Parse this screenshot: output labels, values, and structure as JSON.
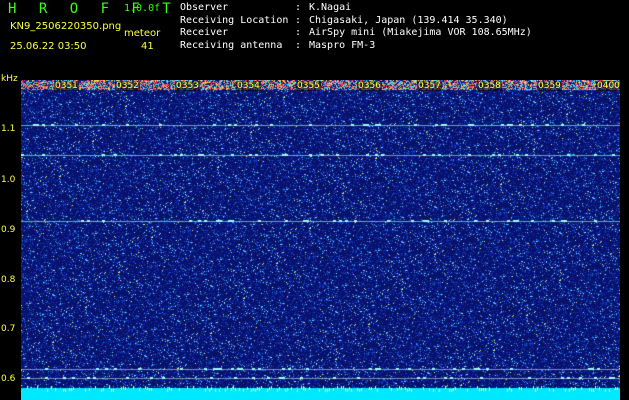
{
  "header": {
    "brand": "H R O F F T",
    "version": "1.0.0f",
    "filename": "KN9_2506220350.png",
    "datetime": "25.06.22 03:50",
    "meteor_label": "meteor",
    "meteor_count": "41"
  },
  "info": [
    {
      "key": "Observer",
      "value": "K.Nagai"
    },
    {
      "key": "Receiving Location",
      "value": "Chigasaki, Japan (139.414 35.340)"
    },
    {
      "key": "Receiver",
      "value": "AirSpy mini (Miakejima VOR 108.65MHz)"
    },
    {
      "key": "Receiving antenna",
      "value": "Maspro FM-3"
    }
  ],
  "separator": ":",
  "y_axis": {
    "unit": "kHz",
    "ticks": [
      "1.1",
      "1.0",
      "0.9",
      "0.8",
      "0.7",
      "0.6"
    ]
  },
  "time_ticks": [
    "0351",
    "0352",
    "0353",
    "0354",
    "0355",
    "0356",
    "0357",
    "0358",
    "0359",
    "0400"
  ],
  "colors": {
    "brand": "#39ff14",
    "label": "#ffff44",
    "background": "#0a1560",
    "trace": "#00ffff"
  }
}
